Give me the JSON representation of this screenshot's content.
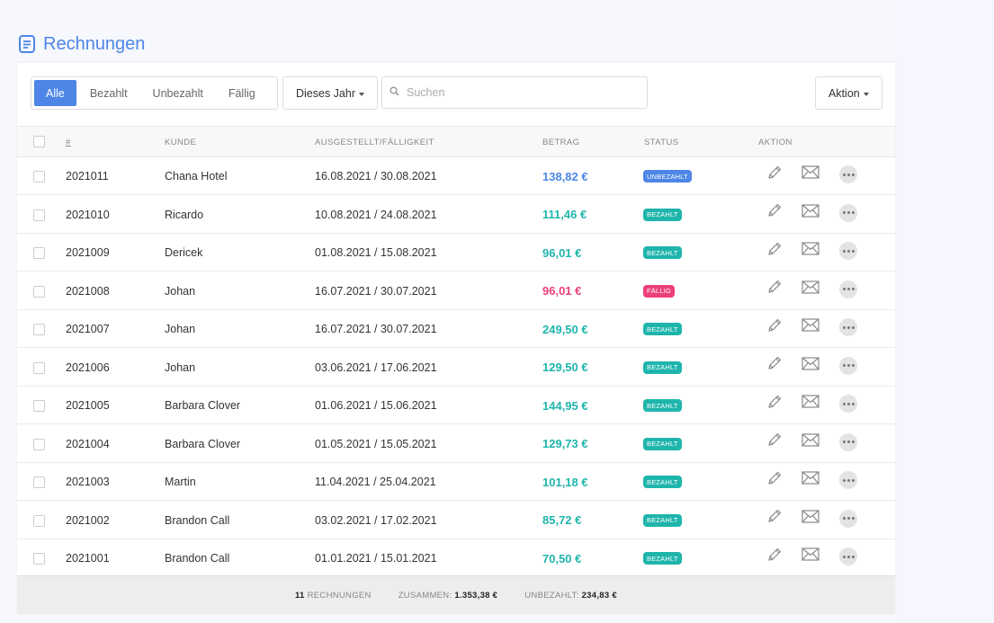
{
  "page": {
    "title": "Rechnungen",
    "accent": "#4d86e6"
  },
  "filters": {
    "tabs": [
      "Alle",
      "Bezahlt",
      "Unbezahlt",
      "Fällig"
    ],
    "active_tab": "Alle",
    "period": "Dieses Jahr",
    "search_placeholder": "Suchen",
    "action_label": "Aktion"
  },
  "table": {
    "headers": {
      "number": "#",
      "customer": "KUNDE",
      "dates": "AUSGESTELLT/FÄLLIGKEIT",
      "amount": "BETRAG",
      "status": "STATUS",
      "action": "AKTION"
    },
    "rows": [
      {
        "number": "2021011",
        "customer": "Chana Hotel",
        "dates": "16.08.2021 / 30.08.2021",
        "amount": "138,82 €",
        "status": "UNBEZAHLT",
        "color": "#4d86e6"
      },
      {
        "number": "2021010",
        "customer": "Ricardo",
        "dates": "10.08.2021 / 24.08.2021",
        "amount": "111,46 €",
        "status": "BEZAHLT",
        "color": "#1fb5ac"
      },
      {
        "number": "2021009",
        "customer": "Dericek",
        "dates": "01.08.2021 / 15.08.2021",
        "amount": "96,01 €",
        "status": "BEZAHLT",
        "color": "#1fb5ac"
      },
      {
        "number": "2021008",
        "customer": "Johan",
        "dates": "16.07.2021 / 30.07.2021",
        "amount": "96,01 €",
        "status": "FÄLLIG",
        "color": "#ec407a"
      },
      {
        "number": "2021007",
        "customer": "Johan",
        "dates": "16.07.2021 / 30.07.2021",
        "amount": "249,50 €",
        "status": "BEZAHLT",
        "color": "#1fb5ac"
      },
      {
        "number": "2021006",
        "customer": "Johan",
        "dates": "03.06.2021 / 17.06.2021",
        "amount": "129,50 €",
        "status": "BEZAHLT",
        "color": "#1fb5ac"
      },
      {
        "number": "2021005",
        "customer": "Barbara Clover",
        "dates": "01.06.2021 / 15.06.2021",
        "amount": "144,95 €",
        "status": "BEZAHLT",
        "color": "#1fb5ac"
      },
      {
        "number": "2021004",
        "customer": "Barbara Clover",
        "dates": "01.05.2021 / 15.05.2021",
        "amount": "129,73 €",
        "status": "BEZAHLT",
        "color": "#1fb5ac"
      },
      {
        "number": "2021003",
        "customer": "Martin",
        "dates": "11.04.2021 / 25.04.2021",
        "amount": "101,18 €",
        "status": "BEZAHLT",
        "color": "#1fb5ac"
      },
      {
        "number": "2021002",
        "customer": "Brandon Call",
        "dates": "03.02.2021 / 17.02.2021",
        "amount": "85,72 €",
        "status": "BEZAHLT",
        "color": "#1fb5ac"
      },
      {
        "number": "2021001",
        "customer": "Brandon Call",
        "dates": "01.01.2021 / 15.01.2021",
        "amount": "70,50 €",
        "status": "BEZAHLT",
        "color": "#1fb5ac"
      }
    ],
    "row_icons": [
      "pencil-icon",
      "envelope-icon",
      "more-icon"
    ]
  },
  "footer": {
    "count": "11",
    "count_label": "RECHNUNGEN",
    "total_label": "ZUSAMMEN:",
    "total_value": "1.353,38 €",
    "unpaid_label": "UNBEZAHLT:",
    "unpaid_value": "234,83 €"
  }
}
